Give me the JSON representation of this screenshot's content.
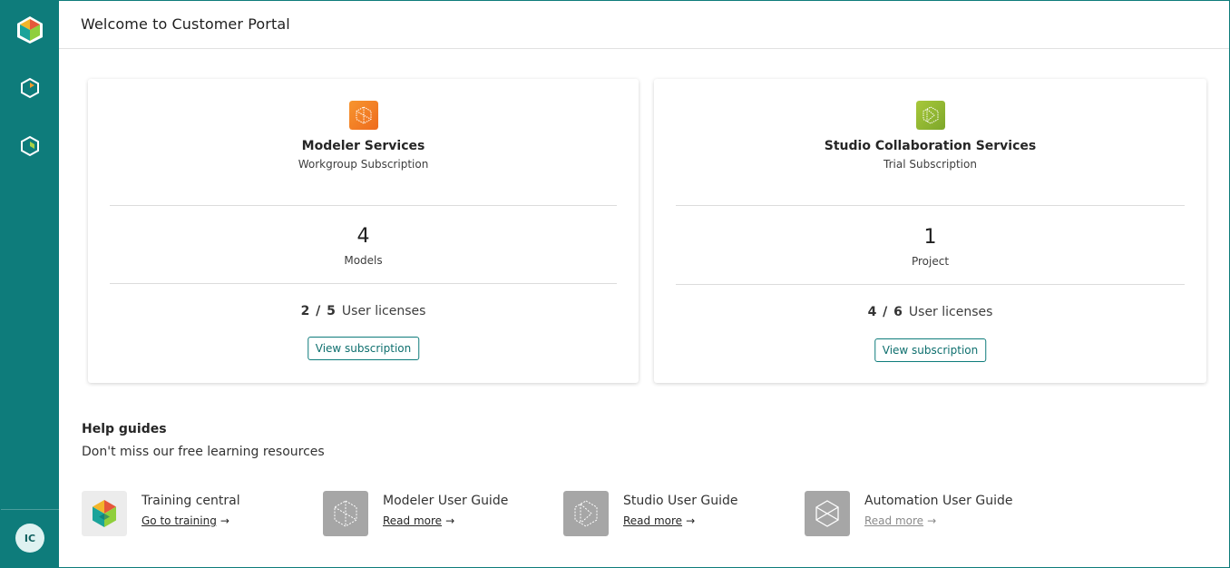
{
  "header": {
    "title": "Welcome to Customer Portal"
  },
  "sidebar": {
    "logo_icon": "app-logo-icon",
    "items": [
      {
        "icon": "modeler-nav-icon"
      },
      {
        "icon": "studio-nav-icon"
      }
    ],
    "avatar_initials": "IC"
  },
  "cards": [
    {
      "icon": "modeler-product-icon",
      "accent": "#f37a22",
      "name": "Modeler Services",
      "subscription": "Workgroup Subscription",
      "count": "4",
      "count_label": "Models",
      "licenses_used": "2 / 5",
      "licenses_label": "User licenses",
      "button_label": "View subscription"
    },
    {
      "icon": "studio-product-icon",
      "accent": "#8bb22e",
      "name": "Studio Collaboration Services",
      "subscription": "Trial Subscription",
      "count": "1",
      "count_label": "Project",
      "licenses_used": "4 / 6",
      "licenses_label": "User licenses",
      "button_label": "View subscription"
    }
  ],
  "help": {
    "title": "Help guides",
    "subtitle": "Don't miss our free learning resources",
    "guides": [
      {
        "icon": "training-central-icon",
        "title": "Training central",
        "link": "Go to training",
        "arrow": "→"
      },
      {
        "icon": "modeler-guide-icon",
        "title": "Modeler User Guide",
        "link": "Read more",
        "arrow": "→"
      },
      {
        "icon": "studio-guide-icon",
        "title": "Studio User Guide",
        "link": "Read more",
        "arrow": "→"
      },
      {
        "icon": "automation-guide-icon",
        "title": "Automation User Guide",
        "link": "Read more",
        "arrow": "→"
      }
    ]
  },
  "colors": {
    "sidebar": "#0e7c7b",
    "accent_teal": "#0e7c7b",
    "guide_icon_bg": "#a6a6a6"
  }
}
